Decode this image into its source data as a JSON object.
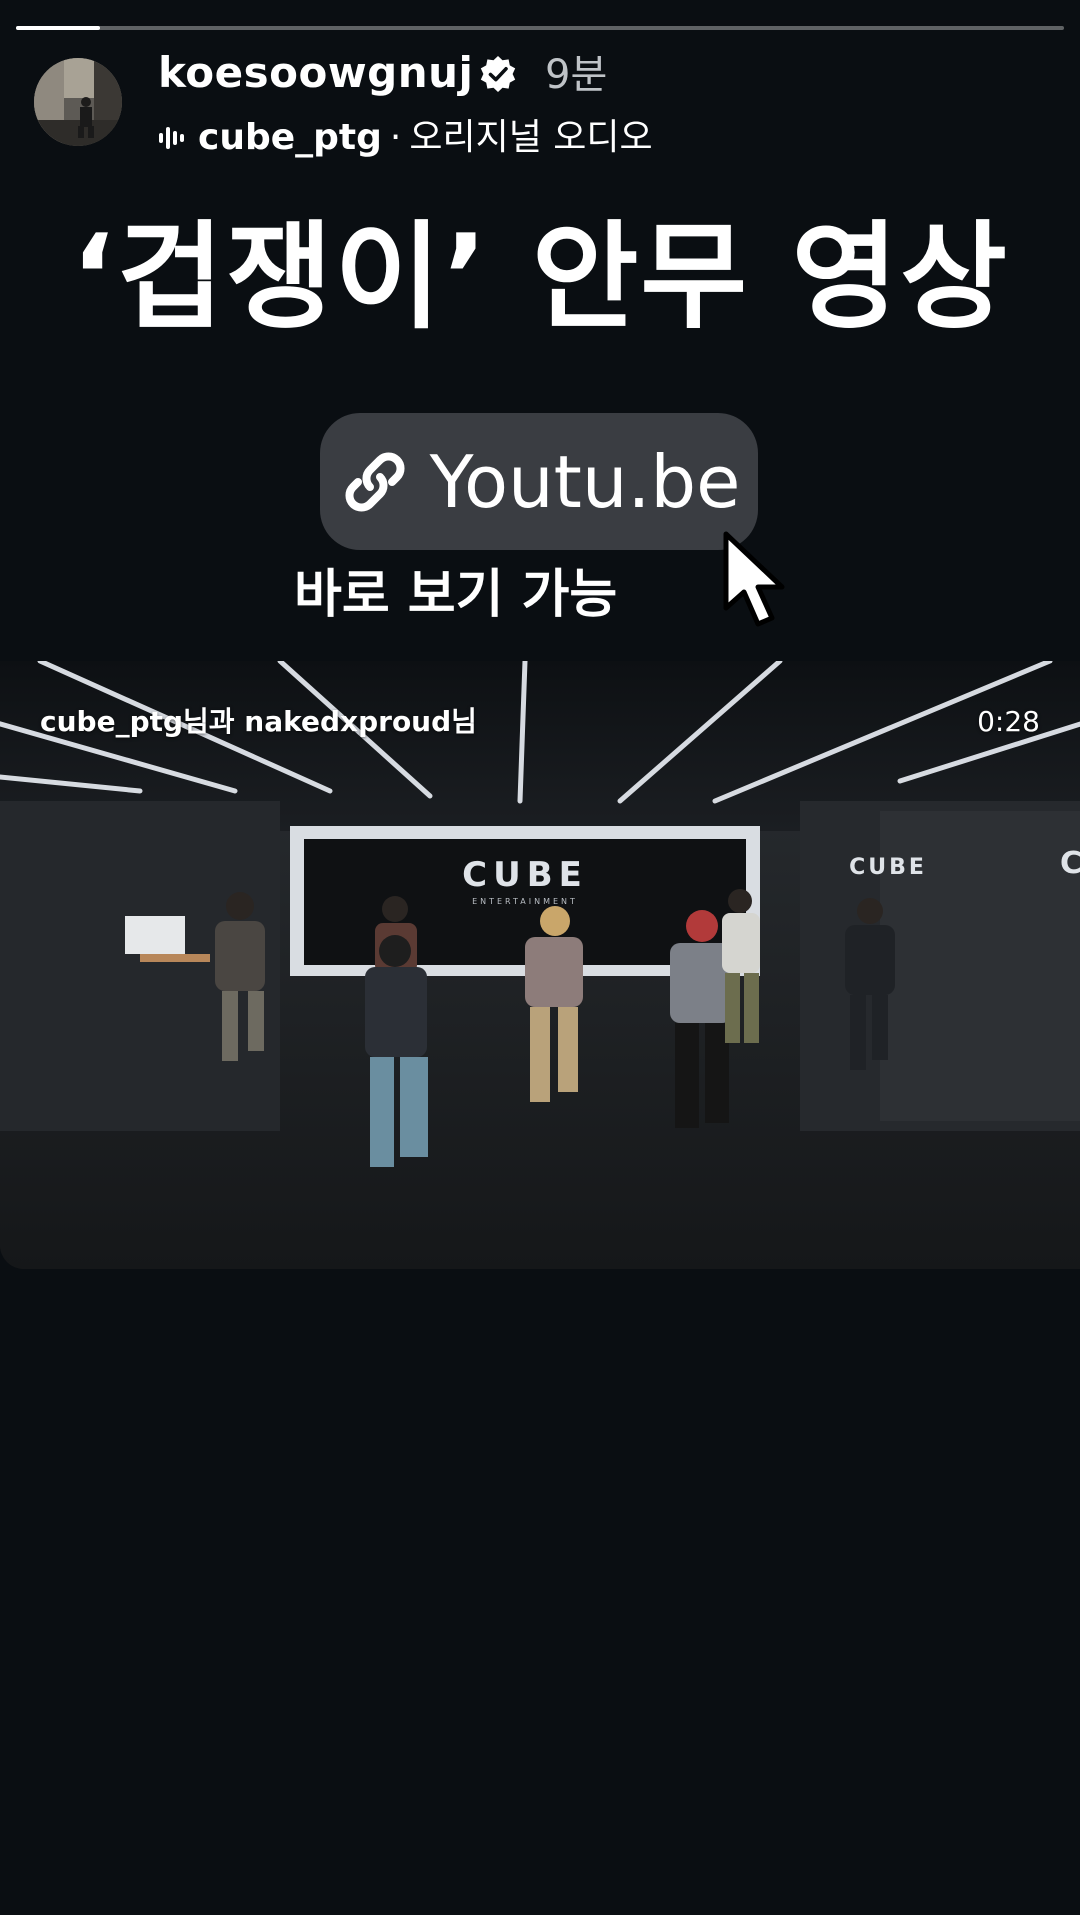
{
  "story": {
    "progress": 0.08
  },
  "header": {
    "username": "koesoowgnuj",
    "time_ago": "9분",
    "audio_source": "cube_ptg",
    "audio_separator": "·",
    "audio_label": "오리지널 오디오"
  },
  "headline": "‘겁쟁이’ 안무 영상",
  "link_sticker": {
    "label": "Youtu.be"
  },
  "sub_caption": "바로 보기 가능",
  "video": {
    "credit": "cube_ptg님과 nakedxproud님",
    "duration": "0:28",
    "wall_logo": "CUBE",
    "wall_logo_sub": "ENTERTAINMENT"
  },
  "colors": {
    "background": "#0a0e12",
    "sticker": "#3a3d42",
    "muted_text": "#bfc3c7"
  },
  "icons": {
    "verified": "verified-badge-icon",
    "audio": "audio-wave-icon",
    "link": "link-icon",
    "cursor": "cursor-arrow-icon"
  }
}
